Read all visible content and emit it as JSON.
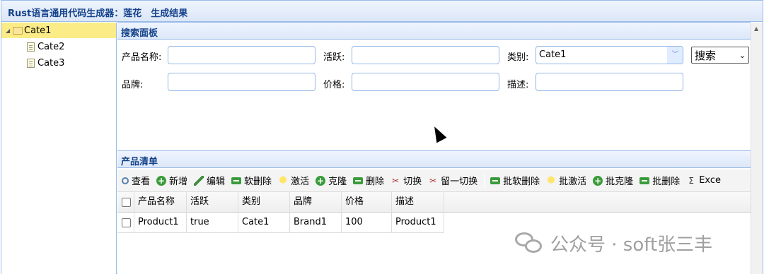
{
  "app": {
    "title": "Rust语言通用代码生成器：莲花　生成结果"
  },
  "tree": {
    "items": [
      {
        "label": "Cate1",
        "type": "folder",
        "selected": true
      },
      {
        "label": "Cate2",
        "type": "file"
      },
      {
        "label": "Cate3",
        "type": "file"
      }
    ]
  },
  "search_panel": {
    "title": "搜索面板",
    "fields": {
      "name_label": "产品名称:",
      "active_label": "活跃:",
      "category_label": "类别:",
      "category_value": "Cate1",
      "brand_label": "品牌:",
      "price_label": "价格:",
      "description_label": "描述:"
    },
    "search_select": "搜索"
  },
  "product_list": {
    "title": "产品清单",
    "toolbar": [
      {
        "label": "查看",
        "icon": "search-icon"
      },
      {
        "label": "新增",
        "icon": "add-icon"
      },
      {
        "label": "编辑",
        "icon": "pencil-icon"
      },
      {
        "label": "软删除",
        "icon": "minus-icon"
      },
      {
        "label": "激活",
        "icon": "bulb-icon"
      },
      {
        "label": "克隆",
        "icon": "add-icon"
      },
      {
        "label": "删除",
        "icon": "minus-icon"
      },
      {
        "label": "切换",
        "icon": "scissors-icon"
      },
      {
        "label": "留一切换",
        "icon": "scissors-icon"
      },
      {
        "label": "批软删除",
        "icon": "minus-icon"
      },
      {
        "label": "批激活",
        "icon": "bulb-icon"
      },
      {
        "label": "批克隆",
        "icon": "add-icon"
      },
      {
        "label": "批删除",
        "icon": "minus-icon"
      },
      {
        "label": "Exce",
        "icon": "sigma-icon"
      }
    ],
    "columns": [
      "产品名称",
      "活跃",
      "类别",
      "品牌",
      "价格",
      "描述"
    ],
    "rows": [
      [
        "Product1",
        "true",
        "Cate1",
        "Brand1",
        "100",
        "Product1"
      ]
    ]
  },
  "watermark": "公众号 · soft张三丰"
}
